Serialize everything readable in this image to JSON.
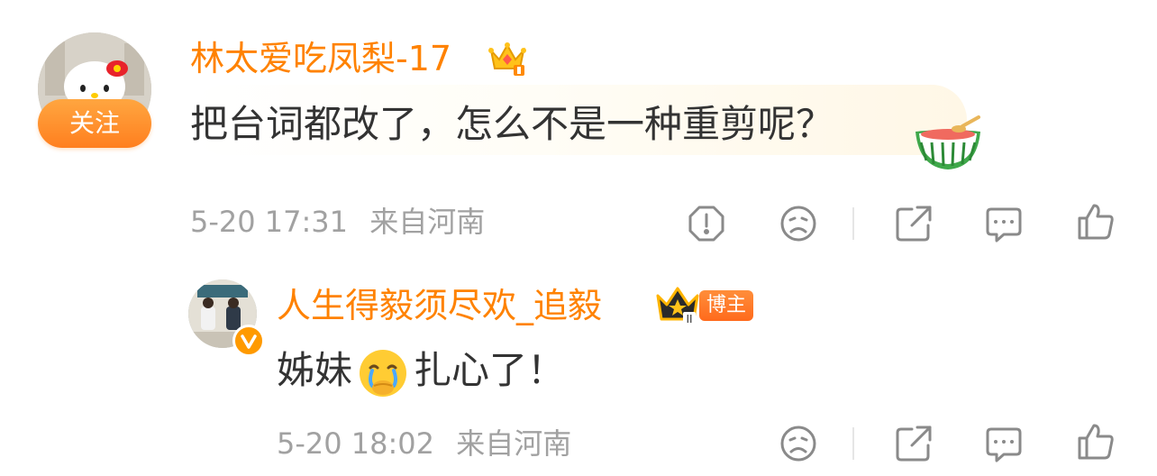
{
  "comment": {
    "username": "林太爱吃凤梨-17",
    "follow_label": "关注",
    "text": "把台词都改了，怎么不是一种重剪呢？",
    "time": "5-20 17:31",
    "location": "来自河南",
    "icons": [
      "report-icon",
      "dislike-icon",
      "share-icon",
      "reply-icon",
      "like-icon"
    ],
    "decorations": [
      "crown-badge-icon",
      "watermelon-sticker-icon"
    ]
  },
  "reply": {
    "username": "人生得毅须尽欢_追毅",
    "host_tag": "博主",
    "text_before": "姊妹",
    "text_after": "扎心了！",
    "emoji": "crying-face-emoji",
    "time": "5-20 18:02",
    "location": "来自河南",
    "icons": [
      "verified-badge-icon",
      "crown-rank-icon",
      "dislike-icon",
      "share-icon",
      "reply-icon",
      "like-icon"
    ]
  },
  "colors": {
    "accent": "#ff8200",
    "text": "#333333",
    "meta": "#a1a1a1",
    "icon": "#8a8a8a"
  }
}
